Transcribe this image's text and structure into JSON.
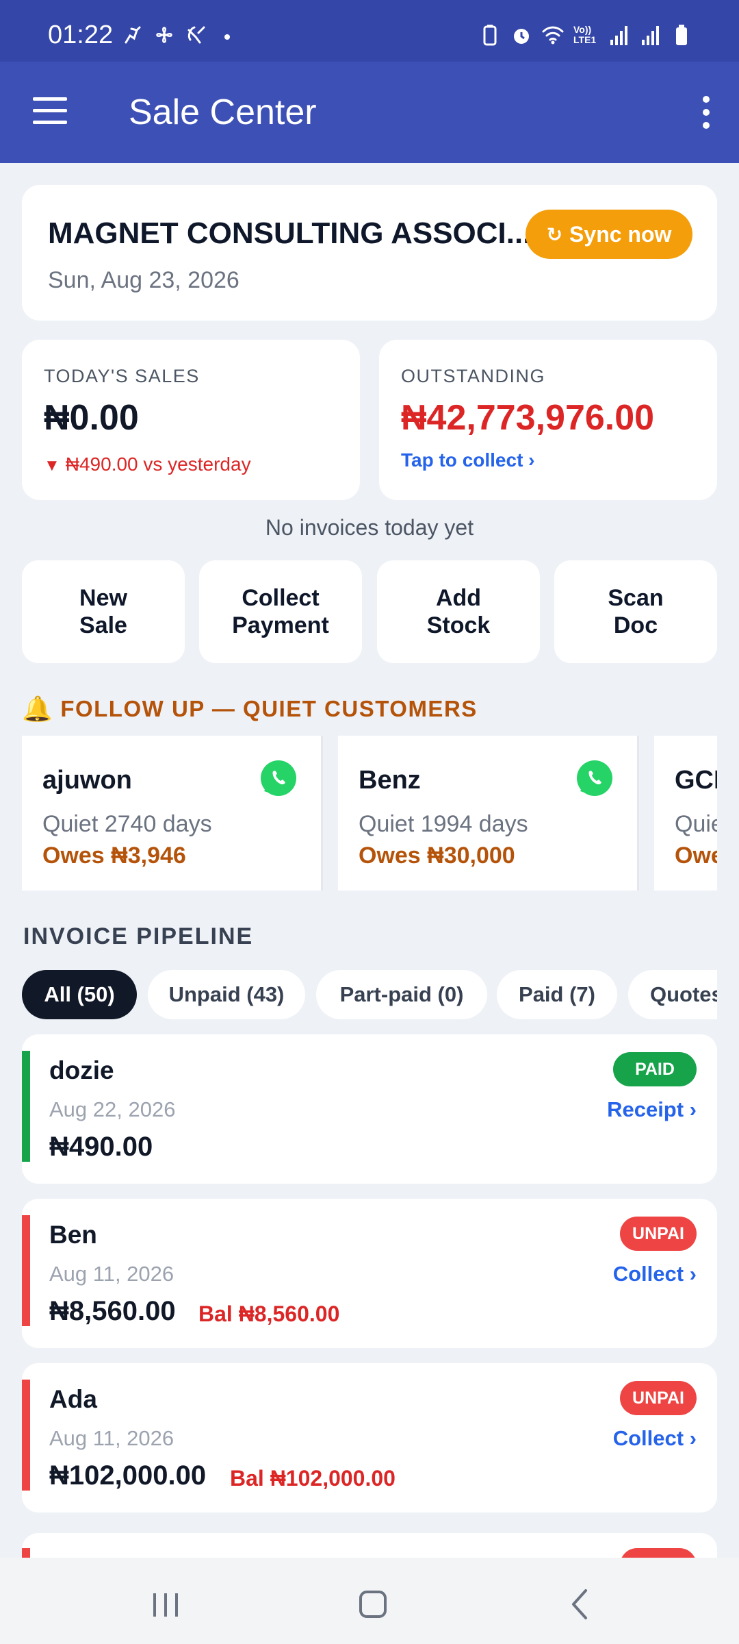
{
  "status_bar": {
    "time": "01:22",
    "left_icons": [
      "activity-icon",
      "fan-icon",
      "satellite-icon",
      "dot-icon"
    ],
    "right_icons": [
      "battery-saver-icon",
      "alarm-icon",
      "wifi-icon",
      "volte-icon",
      "signal-icon",
      "signal-icon",
      "battery-icon"
    ],
    "volte_label_1": "Vo))",
    "volte_label_2": "LTE1"
  },
  "app_bar": {
    "title": "Sale Center"
  },
  "business": {
    "name": "MAGNET CONSULTING ASSOCI...",
    "date": "Sun, Aug 23, 2026",
    "sync_label": "Sync now",
    "sync_icon": "↻"
  },
  "stats": {
    "today": {
      "label": "TODAY'S SALES",
      "value": "₦0.00",
      "trend_icon": "▼",
      "trend": "₦490.00 vs yesterday"
    },
    "outstanding": {
      "label": "OUTSTANDING",
      "value": "₦42,773,976.00",
      "action": "Tap to collect ›"
    }
  },
  "no_invoices_text": "No invoices today yet",
  "actions": [
    "New\nSale",
    "Collect\nPayment",
    "Add\nStock",
    "Scan\nDoc"
  ],
  "follow_up": {
    "icon": "🔔",
    "title": "FOLLOW UP — QUIET CUSTOMERS",
    "customers": [
      {
        "name": "ajuwon",
        "quiet": "Quiet 2740 days",
        "owes": "Owes ₦3,946"
      },
      {
        "name": "Benz",
        "quiet": "Quiet 1994 days",
        "owes": "Owes ₦30,000"
      },
      {
        "name": "GCI",
        "quiet": "Quie",
        "owes": "Owe"
      }
    ]
  },
  "pipeline": {
    "title": "INVOICE PIPELINE",
    "filters": [
      "All (50)",
      "Unpaid (43)",
      "Part-paid (0)",
      "Paid (7)",
      "Quotes"
    ],
    "active_filter": "All (50)",
    "invoices": [
      {
        "name": "dozie",
        "date": "Aug 22, 2026",
        "amount": "₦490.00",
        "balance": "",
        "status": "PAID",
        "action": "Receipt ›"
      },
      {
        "name": "Ben",
        "date": "Aug 11, 2026",
        "amount": "₦8,560.00",
        "balance": "Bal ₦8,560.00",
        "status": "UNPAI",
        "action": "Collect ›"
      },
      {
        "name": "Ada",
        "date": "Aug 11, 2026",
        "amount": "₦102,000.00",
        "balance": "Bal ₦102,000.00",
        "status": "UNPAI",
        "action": "Collect ›"
      }
    ]
  },
  "colors": {
    "status_bar": "#3446a8",
    "app_bar": "#3d50b5",
    "accent_orange": "#f59e0b",
    "follow_text": "#b45309",
    "paid": "#16a34a",
    "unpaid": "#ef4444",
    "link": "#2563eb",
    "whatsapp": "#25d366"
  },
  "nav": [
    "recents-icon",
    "home-icon",
    "back-icon"
  ]
}
